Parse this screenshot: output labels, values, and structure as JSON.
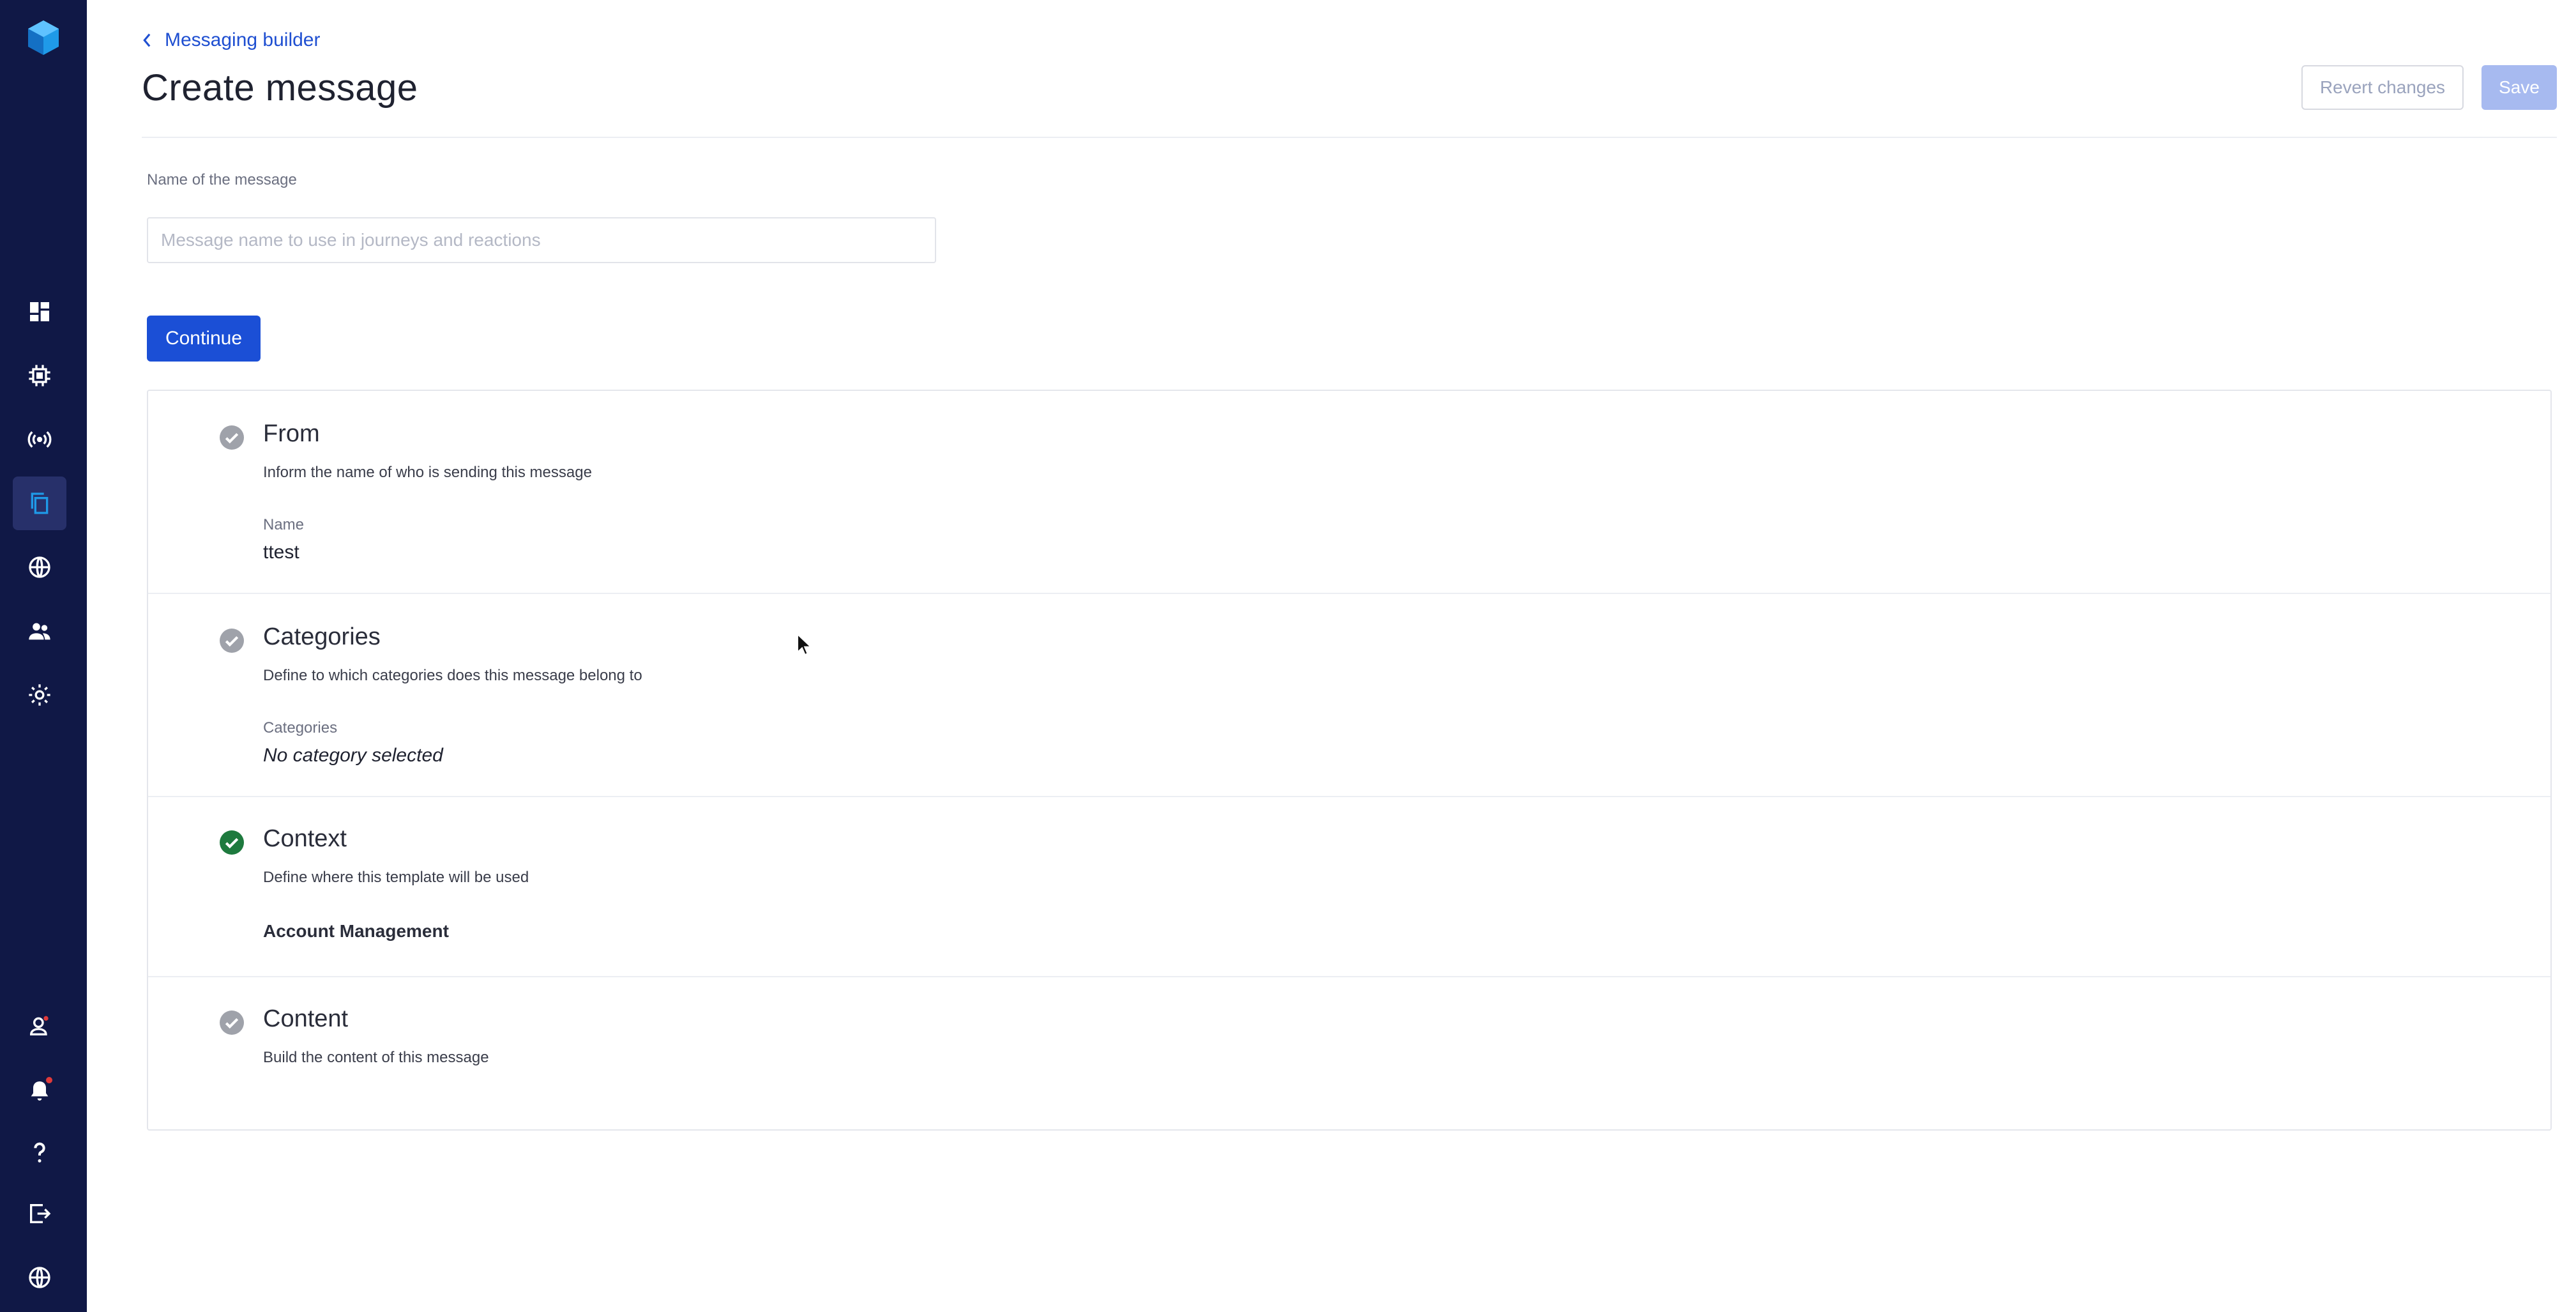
{
  "sidebar": {
    "items": [
      {
        "icon": "dashboard-icon"
      },
      {
        "icon": "chip-icon"
      },
      {
        "icon": "broadcast-icon"
      },
      {
        "icon": "copy-icon",
        "active": true
      },
      {
        "icon": "globe-icon"
      },
      {
        "icon": "users-icon"
      },
      {
        "icon": "gear-icon"
      }
    ],
    "bottom_items": [
      {
        "icon": "user-admin-icon"
      },
      {
        "icon": "bell-icon",
        "has_badge": true
      },
      {
        "icon": "help-icon"
      },
      {
        "icon": "logout-icon"
      },
      {
        "icon": "language-globe-icon"
      }
    ],
    "colors": {
      "background": "#101846",
      "active": "#27306a",
      "logo": "#1f9ae8"
    }
  },
  "header": {
    "back_label": "Messaging builder",
    "title": "Create message",
    "revert_label": "Revert changes",
    "save_label": "Save"
  },
  "form": {
    "name_label": "Name of the message",
    "name_value": "",
    "name_placeholder": "Message name to use in journeys and reactions",
    "continue_label": "Continue"
  },
  "steps": [
    {
      "title": "From",
      "description": "Inform the name of who is sending this message",
      "sublabel": "Name",
      "value": "ttest",
      "status": "pending"
    },
    {
      "title": "Categories",
      "description": "Define to which categories does this message belong to",
      "sublabel": "Categories",
      "value": "No category selected",
      "status": "pending"
    },
    {
      "title": "Context",
      "description": "Define where this template will be used",
      "value": "Account Management",
      "status": "complete"
    },
    {
      "title": "Content",
      "description": "Build the content of this message",
      "status": "pending"
    }
  ],
  "colors": {
    "primary": "#1b4fd6",
    "link": "#1f4fd1",
    "complete": "#1e7a3e",
    "pending": "#9fa2aa"
  }
}
